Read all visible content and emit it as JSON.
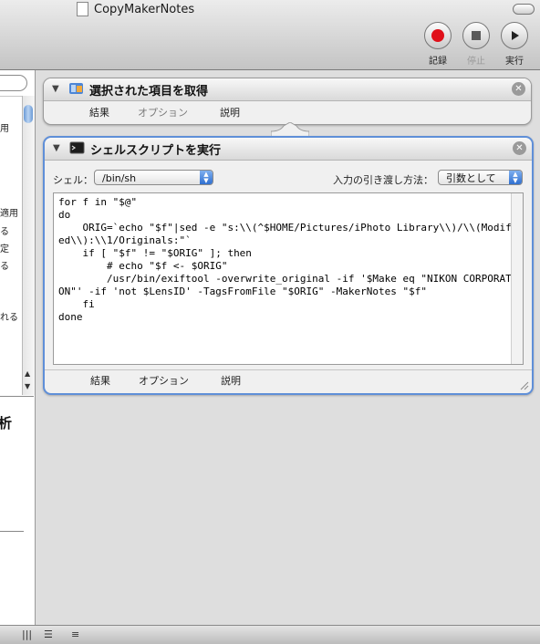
{
  "window": {
    "title": "CopyMakerNotes"
  },
  "toolbar": {
    "record_label": "記録",
    "stop_label": "停止",
    "run_label": "実行"
  },
  "left_panel": {
    "list_fragments": [
      "用",
      "適用",
      "る",
      "定",
      "る",
      "れる"
    ],
    "description_title_fragment": "析"
  },
  "actions": [
    {
      "title": "選択された項目を取得",
      "icon": "finder-get-items-icon",
      "tabs": {
        "results": "結果",
        "options": "オプション",
        "description": "説明"
      }
    },
    {
      "title": "シェルスクリプトを実行",
      "icon": "terminal-icon",
      "shell_label": "シェル：",
      "shell_value": "/bin/sh",
      "input_method_label": "入力の引き渡し方法：",
      "input_method_value": "引数として",
      "script": "for f in \"$@\"\ndo\n    ORIG=`echo \"$f\"|sed -e \"s:\\\\(^$HOME/Pictures/iPhoto Library\\\\)/\\\\(Modified\\\\):\\\\1/Originals:\"`\n    if [ \"$f\" != \"$ORIG\" ]; then\n        # echo \"$f <- $ORIG\"\n        /usr/bin/exiftool -overwrite_original -if '$Make eq \"NIKON CORPORATION\"' -if 'not $LensID' -TagsFromFile \"$ORIG\" -MakerNotes \"$f\"\n    fi\ndone",
      "tabs": {
        "results": "結果",
        "options": "オプション",
        "description": "説明"
      }
    }
  ],
  "colors": {
    "selection_border": "#5f8fd8",
    "record_red": "#e0101a",
    "popup_blue": "#2f6fd0"
  }
}
